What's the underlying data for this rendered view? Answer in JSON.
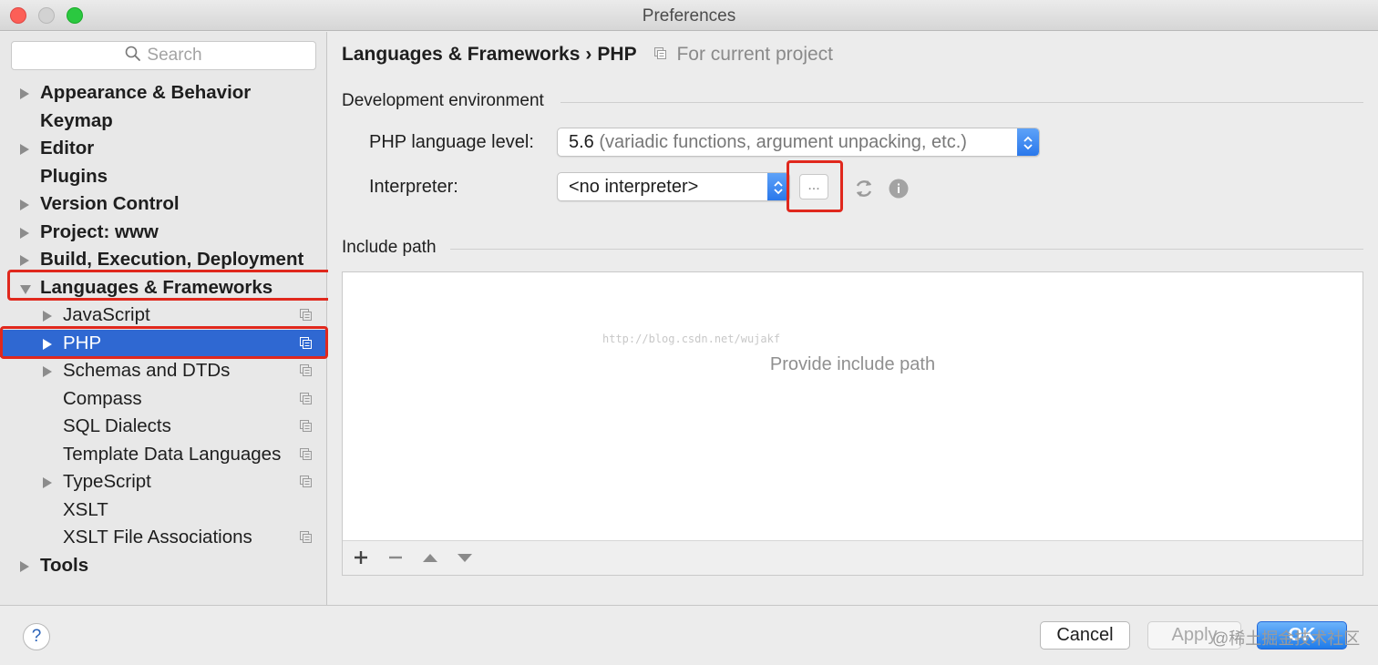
{
  "window": {
    "title": "Preferences"
  },
  "sidebar": {
    "search_placeholder": "Search",
    "items": [
      {
        "label": "Appearance & Behavior",
        "level": 0,
        "expandable": true,
        "expanded": false,
        "project_scope": false
      },
      {
        "label": "Keymap",
        "level": 0,
        "expandable": false,
        "project_scope": false
      },
      {
        "label": "Editor",
        "level": 0,
        "expandable": true,
        "expanded": false,
        "project_scope": false
      },
      {
        "label": "Plugins",
        "level": 0,
        "expandable": false,
        "project_scope": false
      },
      {
        "label": "Version Control",
        "level": 0,
        "expandable": true,
        "expanded": false,
        "project_scope": false
      },
      {
        "label": "Project: www",
        "level": 0,
        "expandable": true,
        "expanded": false,
        "project_scope": false
      },
      {
        "label": "Build, Execution, Deployment",
        "level": 0,
        "expandable": true,
        "expanded": false,
        "project_scope": false
      },
      {
        "label": "Languages & Frameworks",
        "level": 0,
        "expandable": true,
        "expanded": true,
        "project_scope": false,
        "highlighted": true
      },
      {
        "label": "JavaScript",
        "level": 1,
        "expandable": true,
        "expanded": false,
        "project_scope": true
      },
      {
        "label": "PHP",
        "level": 1,
        "expandable": true,
        "expanded": false,
        "project_scope": true,
        "selected": true,
        "highlighted": true
      },
      {
        "label": "Schemas and DTDs",
        "level": 1,
        "expandable": true,
        "expanded": false,
        "project_scope": true
      },
      {
        "label": "Compass",
        "level": 1,
        "expandable": false,
        "project_scope": true
      },
      {
        "label": "SQL Dialects",
        "level": 1,
        "expandable": false,
        "project_scope": true
      },
      {
        "label": "Template Data Languages",
        "level": 1,
        "expandable": false,
        "project_scope": true
      },
      {
        "label": "TypeScript",
        "level": 1,
        "expandable": true,
        "expanded": false,
        "project_scope": true
      },
      {
        "label": "XSLT",
        "level": 1,
        "expandable": false,
        "project_scope": false
      },
      {
        "label": "XSLT File Associations",
        "level": 1,
        "expandable": false,
        "project_scope": true
      },
      {
        "label": "Tools",
        "level": 0,
        "expandable": true,
        "expanded": false,
        "project_scope": false
      }
    ]
  },
  "main": {
    "breadcrumb": {
      "parent": "Languages & Frameworks",
      "separator": "›",
      "current": "PHP",
      "scope": "For current project"
    },
    "dev_env": {
      "title": "Development environment",
      "language_level_label": "PHP language level:",
      "language_level_value": "5.6",
      "language_level_desc": "(variadic functions, argument unpacking, etc.)",
      "interpreter_label": "Interpreter:",
      "interpreter_value": "<no interpreter>",
      "browse_button": "..."
    },
    "include_path": {
      "title": "Include path",
      "empty_text": "Provide include path",
      "watermark": "http://blog.csdn.net/wujakf"
    }
  },
  "footer": {
    "help": "?",
    "cancel": "Cancel",
    "apply": "Apply",
    "ok": "OK",
    "watermark": "@稀土掘金技术社区"
  },
  "colors": {
    "selection": "#2f68d2",
    "highlight_box": "#e0281d",
    "accent": "#2a78eb"
  }
}
